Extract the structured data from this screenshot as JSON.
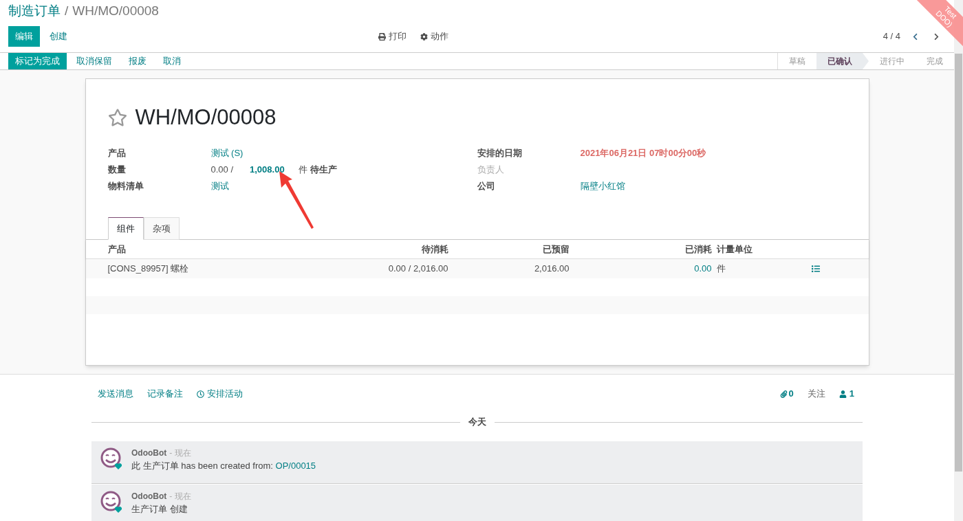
{
  "breadcrumb": {
    "parent": "制造订单",
    "separator": "/",
    "current": "WH/MO/00008"
  },
  "main_buttons": [
    {
      "label": "编辑",
      "kind": "primary"
    },
    {
      "label": "创建",
      "kind": "link"
    }
  ],
  "sidebar_actions": [
    {
      "label": "打印",
      "kind": "print"
    },
    {
      "label": "动作",
      "kind": "gear"
    }
  ],
  "pager": "4 / 4",
  "ribbon": [
    "Test",
    "DOO)"
  ],
  "status_buttons": [
    {
      "label": "标记为完成",
      "kind": "primary"
    },
    {
      "label": "取消保留",
      "kind": "link"
    },
    {
      "label": "报废",
      "kind": "link"
    },
    {
      "label": "取消",
      "kind": "link"
    }
  ],
  "stages": [
    {
      "label": "草稿",
      "selected": false
    },
    {
      "label": "已确认",
      "selected": true
    },
    {
      "label": "进行中",
      "selected": false
    },
    {
      "label": "完成",
      "selected": false
    }
  ],
  "form": {
    "favorite": false,
    "title": "WH/MO/00008",
    "left_fields": [
      {
        "label": "产品",
        "kind": "link",
        "value": "测试 (S)"
      },
      {
        "label": "数量",
        "kind": "quantity",
        "produced": "0.00 /",
        "target": "1,008.00",
        "uom": "件",
        "state": "待生产"
      },
      {
        "label": "物料清单",
        "kind": "link",
        "value": "测试"
      }
    ],
    "right_fields": [
      {
        "label": "安排的日期",
        "kind": "date",
        "value": "2021年06月21日 07时00分00秒"
      },
      {
        "label": "负责人",
        "kind": "empty"
      },
      {
        "label": "公司",
        "kind": "link",
        "value": "隔壁小红馆"
      }
    ],
    "tabs": [
      {
        "label": "组件",
        "selected": true
      },
      {
        "label": "杂项",
        "selected": false
      }
    ],
    "table": {
      "columns": [
        "产品",
        "待消耗",
        "已预留",
        "已消耗",
        "计量单位"
      ],
      "rows": [
        {
          "product": "[CONS_89957] 螺栓",
          "to_consume": "0.00 / 2,016.00",
          "reserved": "2,016.00",
          "consumed": "0.00",
          "uom": "件"
        }
      ]
    }
  },
  "chatter": {
    "buttons": [
      {
        "label": "发送消息",
        "kind": "plain"
      },
      {
        "label": "记录备注",
        "kind": "plain"
      },
      {
        "label": "安排活动",
        "kind": "clock"
      }
    ],
    "attachments": "0",
    "follow": "关注",
    "followers": "1",
    "day": "今天",
    "messages": [
      {
        "author": "OdooBot",
        "time": "- 现在",
        "text": "此 生产订单 has been created from: ",
        "link": "OP/00015"
      },
      {
        "author": "OdooBot",
        "time": "- 现在",
        "text": "生产订单 创建"
      }
    ]
  }
}
